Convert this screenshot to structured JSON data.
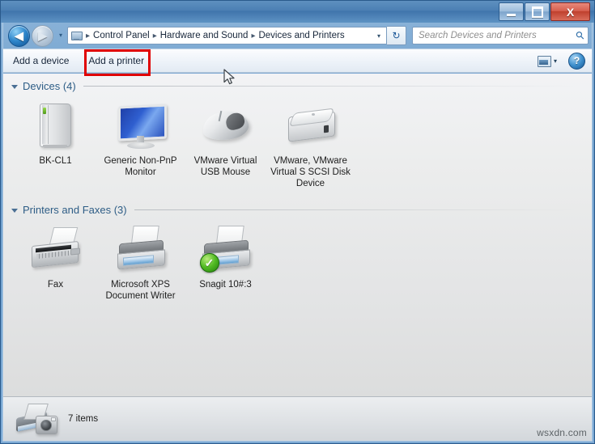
{
  "window": {
    "controls": {
      "minimize_label": "Minimize",
      "maximize_label": "Maximize",
      "close_label": "X"
    }
  },
  "navigation": {
    "back_label": "◀",
    "forward_label": "▶",
    "history_caret": "▾",
    "breadcrumb": {
      "icon": "control-panel-icon",
      "segments": [
        "Control Panel",
        "Hardware and Sound",
        "Devices and Printers"
      ],
      "separator": "▸",
      "dropdown_caret": "▾"
    },
    "refresh_label": "↻"
  },
  "search": {
    "placeholder": "Search Devices and Printers",
    "value": "",
    "icon": "search-icon"
  },
  "toolbar": {
    "items": [
      {
        "label": "Add a device",
        "name": "add-a-device"
      },
      {
        "label": "Add a printer",
        "name": "add-a-printer"
      }
    ],
    "view_icon": "view-options-icon",
    "view_caret": "▾",
    "help_label": "?"
  },
  "groups": [
    {
      "name": "devices",
      "title": "Devices (4)",
      "collapse_caret": "▾",
      "items": [
        {
          "label": "BK-CL1",
          "icon": "computer-tower-icon",
          "default": false
        },
        {
          "label": "Generic Non-PnP Monitor",
          "icon": "monitor-icon",
          "default": false
        },
        {
          "label": "VMware Virtual USB Mouse",
          "icon": "mouse-icon",
          "default": false
        },
        {
          "label": "VMware, VMware Virtual S SCSI Disk Device",
          "icon": "disk-drive-icon",
          "default": false
        }
      ]
    },
    {
      "name": "printers-and-faxes",
      "title": "Printers and Faxes (3)",
      "collapse_caret": "▾",
      "items": [
        {
          "label": "Fax",
          "icon": "fax-icon",
          "default": false
        },
        {
          "label": "Microsoft XPS Document Writer",
          "icon": "printer-icon",
          "default": false
        },
        {
          "label": "Snagit 10#:3",
          "icon": "printer-icon",
          "default": true,
          "badge": "✓"
        }
      ]
    }
  ],
  "details_pane": {
    "icon": "printer-camera-icon",
    "status_text": "7 items"
  },
  "annotation": {
    "target": "Add a printer",
    "color": "#e00000"
  },
  "watermark": {
    "text": "wsxdn.com"
  }
}
